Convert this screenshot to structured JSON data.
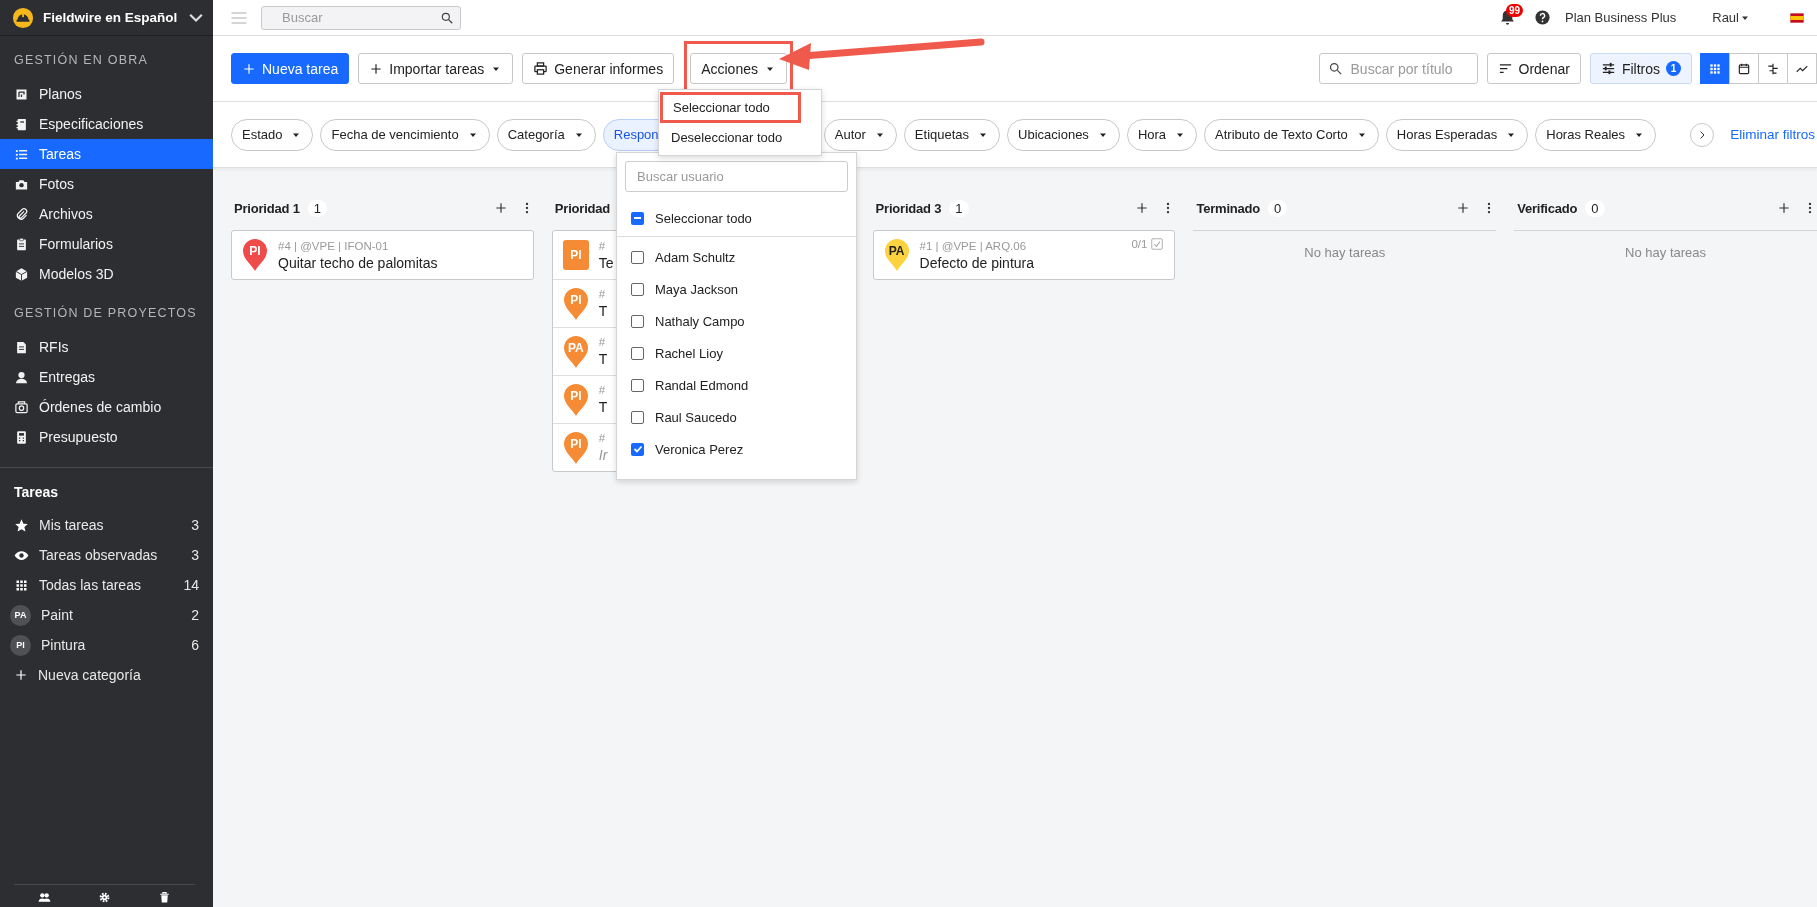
{
  "sidebar": {
    "project": "Fieldwire en Español",
    "sections": [
      {
        "heading": "GESTIÓN EN OBRA",
        "items": [
          {
            "label": "Planos",
            "selected": false
          },
          {
            "label": "Especificaciones",
            "selected": false
          },
          {
            "label": "Tareas",
            "selected": true
          },
          {
            "label": "Fotos",
            "selected": false
          },
          {
            "label": "Archivos",
            "selected": false
          },
          {
            "label": "Formularios",
            "selected": false
          },
          {
            "label": "Modelos 3D",
            "selected": false
          }
        ]
      },
      {
        "heading": "GESTIÓN DE PROYECTOS",
        "items": [
          {
            "label": "RFIs",
            "selected": false
          },
          {
            "label": "Entregas",
            "selected": false
          },
          {
            "label": "Órdenes de cambio",
            "selected": false
          },
          {
            "label": "Presupuesto",
            "selected": false
          }
        ]
      }
    ],
    "task_lists": {
      "heading": "Tareas",
      "items": [
        {
          "kind": "icon",
          "label": "Mis tareas",
          "count": "3"
        },
        {
          "kind": "icon",
          "label": "Tareas observadas",
          "count": "3"
        },
        {
          "kind": "icon",
          "label": "Todas las tareas",
          "count": "14"
        },
        {
          "kind": "avatar",
          "avatar": "PA",
          "label": "Paint",
          "count": "2"
        },
        {
          "kind": "avatar",
          "avatar": "PI",
          "label": "Pintura",
          "count": "6"
        },
        {
          "kind": "action",
          "label": "Nueva categoría"
        }
      ]
    }
  },
  "topbar": {
    "search": {
      "placeholder": "Buscar"
    },
    "notifications": "99",
    "plan": "Plan Business Plus",
    "user": "Raul"
  },
  "toolbar": {
    "buttons": [
      {
        "kind": "primary",
        "label": "Nueva tarea",
        "highlighted": false,
        "callout_arrow": false
      },
      {
        "kind": "dropdown",
        "label": "Importar tareas",
        "highlighted": false,
        "callout_arrow": false
      },
      {
        "kind": "print",
        "label": "Generar informes",
        "highlighted": false,
        "callout_arrow": false
      },
      {
        "kind": "dropdown",
        "label": "Acciones",
        "highlighted": true,
        "callout_arrow": true
      }
    ],
    "title_search": {
      "placeholder": "Buscar por título"
    },
    "sort": "Ordenar",
    "filters": {
      "label": "Filtros",
      "count": "1"
    },
    "views": [
      {
        "selected": true
      },
      {
        "selected": false
      },
      {
        "selected": false
      },
      {
        "selected": false
      }
    ]
  },
  "filters": {
    "chips": [
      {
        "label": "Estado",
        "active": false
      },
      {
        "label": "Fecha de vencimiento",
        "active": false
      },
      {
        "label": "Categoría",
        "active": false
      },
      {
        "label": "Respon",
        "active": true
      },
      {
        "label": "Autor",
        "active": false
      },
      {
        "label": "Etiquetas",
        "active": false
      },
      {
        "label": "Ubicaciones",
        "active": false
      },
      {
        "label": "Hora",
        "active": false
      },
      {
        "label": "Atributo de Texto Corto",
        "active": false
      },
      {
        "label": "Horas Esperadas",
        "active": false
      },
      {
        "label": "Horas Reales",
        "active": false
      }
    ],
    "clear": "Eliminar filtros"
  },
  "board": {
    "columns": [
      {
        "title": "Prioridad 1",
        "count": "1",
        "cards": [
          {
            "marker": {
              "kind": "pin",
              "text": "PI",
              "color": "#f04b4b"
            },
            "meta": "#4 | @VPE | IFON-01",
            "title": "Quitar techo de palomitas",
            "untitled": false
          }
        ]
      },
      {
        "title": "Prioridad",
        "cards": [
          {
            "marker": {
              "kind": "square",
              "text": "PI",
              "color": "#f58b35"
            },
            "meta": "#",
            "title": "Te",
            "untitled": false
          },
          {
            "marker": {
              "kind": "pin",
              "text": "PI",
              "color": "#f58b35"
            },
            "meta": "#",
            "title": "T",
            "untitled": false
          },
          {
            "marker": {
              "kind": "pin",
              "text": "PA",
              "color": "#f58b35"
            },
            "meta": "#",
            "title": "T",
            "untitled": false
          },
          {
            "marker": {
              "kind": "pin",
              "text": "PI",
              "color": "#f58b35"
            },
            "meta": "#",
            "title": "T",
            "untitled": false
          },
          {
            "marker": {
              "kind": "pin",
              "text": "PI",
              "color": "#f58b35"
            },
            "meta": "#",
            "title": "Ir",
            "untitled": true
          }
        ]
      },
      {
        "title": "Prioridad 3",
        "count": "1",
        "cards": [
          {
            "marker": {
              "kind": "pin",
              "text": "PA",
              "color": "#fcd23f"
            },
            "meta": "#1 | @VPE | ARQ.06",
            "title": "Defecto de pintura",
            "untitled": false,
            "checklist": "0/1"
          }
        ]
      },
      {
        "title": "Terminado",
        "count": "0",
        "empty": "No hay tareas"
      },
      {
        "title": "Verificado",
        "count": "0",
        "empty": "No hay tareas"
      }
    ]
  },
  "actions_menu": {
    "items": [
      {
        "label": "Seleccionar todo",
        "highlighted": true
      },
      {
        "label": "Deseleccionar todo",
        "highlighted": false
      }
    ]
  },
  "user_filter": {
    "search": {
      "placeholder": "Buscar usuario"
    },
    "select_all": {
      "label": "Seleccionar todo",
      "indeterminate": true
    },
    "users": [
      {
        "name": "Adam Schultz",
        "checked": false
      },
      {
        "name": "Maya Jackson",
        "checked": false
      },
      {
        "name": "Nathaly Campo",
        "checked": false
      },
      {
        "name": "Rachel Lioy",
        "checked": false
      },
      {
        "name": "Randal Edmond",
        "checked": false
      },
      {
        "name": "Raul Saucedo",
        "checked": false
      },
      {
        "name": "Veronica Perez",
        "checked": true
      }
    ]
  }
}
